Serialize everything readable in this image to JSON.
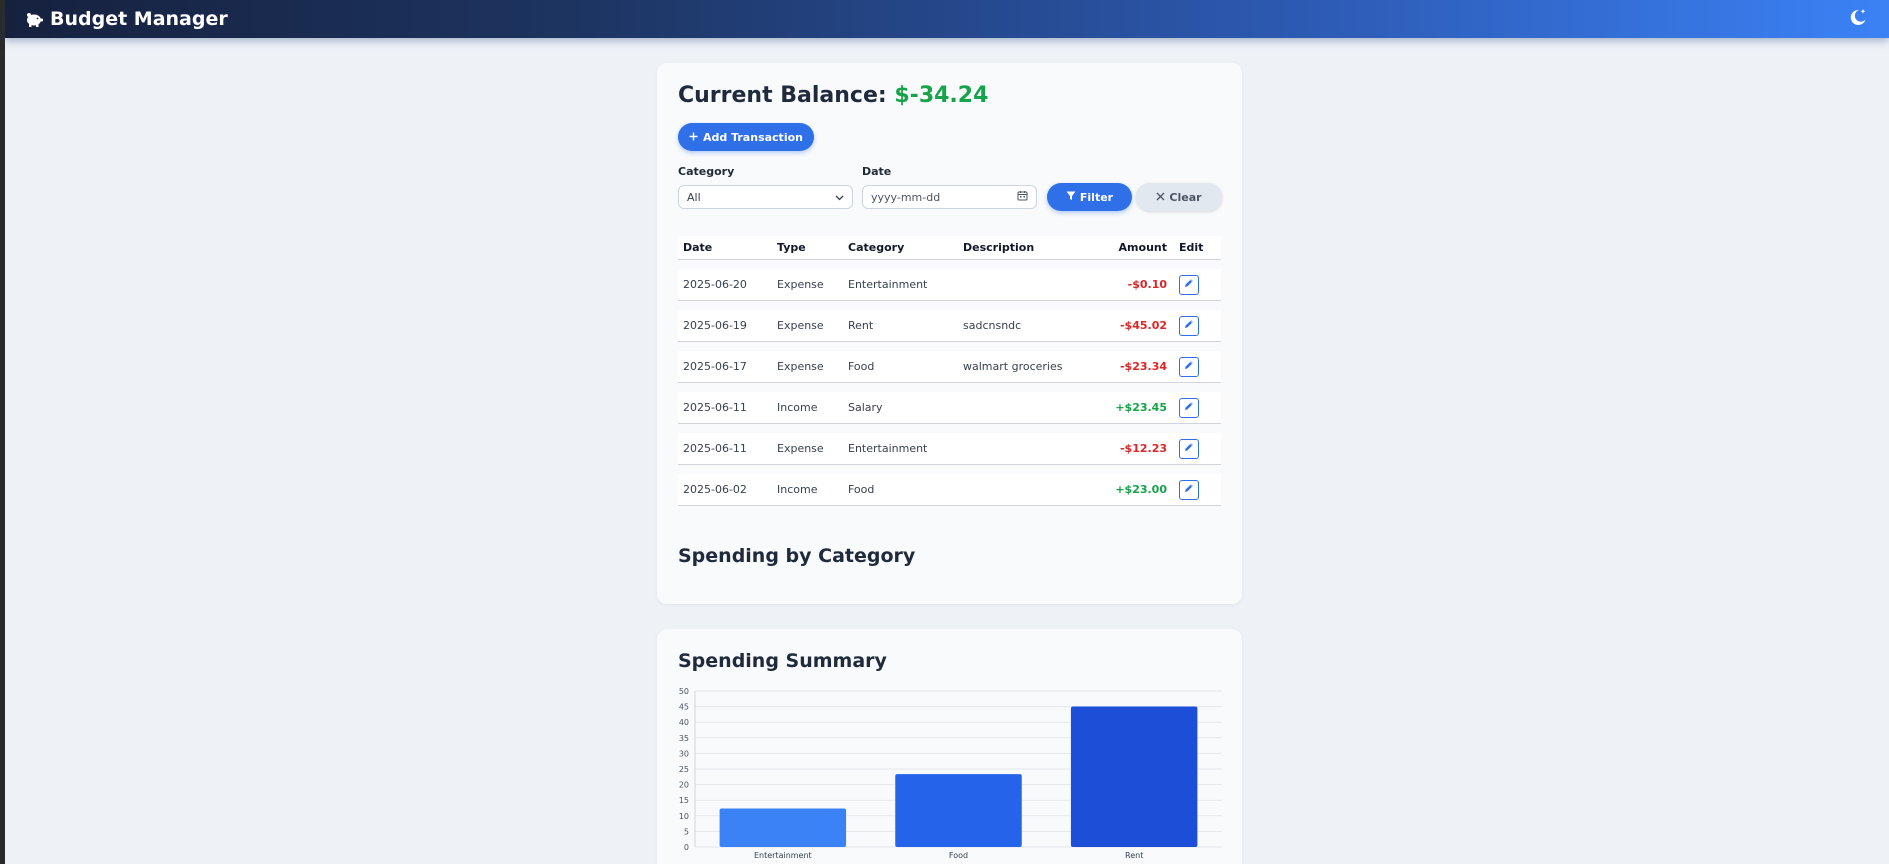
{
  "app": {
    "title": "Budget Manager",
    "brand_icon": "piggy-bank-icon",
    "theme_icon": "moon-stars-icon"
  },
  "balance": {
    "label": "Current Balance:",
    "value": "$-34.24",
    "value_color": "#16a34a"
  },
  "actions": {
    "add_label": "Add Transaction",
    "filter_label": "Filter",
    "clear_label": "Clear"
  },
  "filters": {
    "category_label": "Category",
    "category_value": "All",
    "date_label": "Date",
    "date_placeholder": "yyyy-mm-dd"
  },
  "table": {
    "headers": [
      "Date",
      "Type",
      "Category",
      "Description",
      "Amount",
      "Edit"
    ],
    "rows": [
      {
        "date": "2025-06-20",
        "type": "Expense",
        "category": "Entertainment",
        "description": "",
        "amount": "-$0.10",
        "kind": "neg"
      },
      {
        "date": "2025-06-19",
        "type": "Expense",
        "category": "Rent",
        "description": "sadcnsndc",
        "amount": "-$45.02",
        "kind": "neg"
      },
      {
        "date": "2025-06-17",
        "type": "Expense",
        "category": "Food",
        "description": "walmart groceries",
        "amount": "-$23.34",
        "kind": "neg"
      },
      {
        "date": "2025-06-11",
        "type": "Income",
        "category": "Salary",
        "description": "",
        "amount": "+$23.45",
        "kind": "pos"
      },
      {
        "date": "2025-06-11",
        "type": "Expense",
        "category": "Entertainment",
        "description": "",
        "amount": "-$12.23",
        "kind": "neg"
      },
      {
        "date": "2025-06-02",
        "type": "Income",
        "category": "Food",
        "description": "",
        "amount": "+$23.00",
        "kind": "pos"
      }
    ]
  },
  "sections": {
    "spending_by_category": "Spending by Category",
    "spending_summary": "Spending Summary"
  },
  "colors": {
    "accent": "#2f6fe8",
    "negative": "#dc2626",
    "positive": "#16a34a"
  },
  "chart_data": {
    "type": "bar",
    "categories": [
      "Entertainment",
      "Food",
      "Rent"
    ],
    "values": [
      12.33,
      23.34,
      45.02
    ],
    "bar_colors": [
      "#3b82f6",
      "#2563eb",
      "#1d4ed8"
    ],
    "ylim": [
      0,
      50
    ],
    "yticks": [
      0,
      5,
      10,
      15,
      20,
      25,
      30,
      35,
      40,
      45,
      50
    ],
    "grid": true
  }
}
